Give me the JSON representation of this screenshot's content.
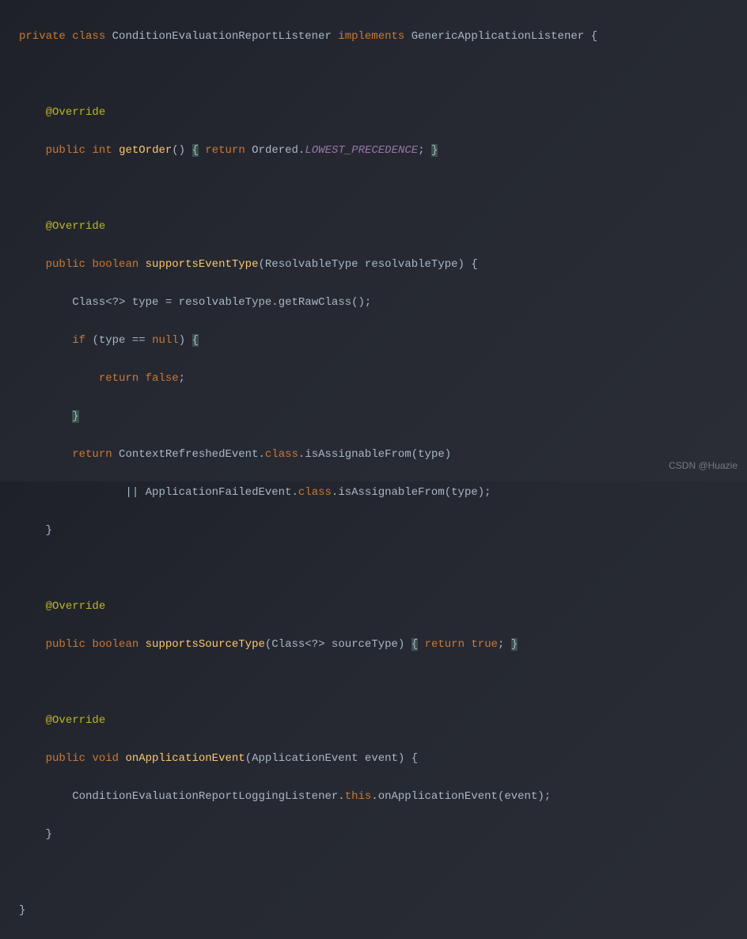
{
  "code": {
    "line1": {
      "kw_private": "private",
      "kw_class": "class",
      "class_name": "ConditionEvaluationReportListener",
      "kw_implements": "implements",
      "interface_name": "GenericApplicationListener",
      "brace_open": "{"
    },
    "line3": {
      "annotation": "@Override"
    },
    "line4": {
      "kw_public": "public",
      "kw_int": "int",
      "method": "getOrder",
      "parens": "()",
      "brace_open": "{",
      "kw_return": "return",
      "class_ref": "Ordered",
      "dot": ".",
      "static_field": "LOWEST_PRECEDENCE",
      "semi": ";",
      "brace_close": "}"
    },
    "line6": {
      "annotation": "@Override"
    },
    "line7": {
      "kw_public": "public",
      "kw_boolean": "boolean",
      "method": "supportsEventType",
      "paren_open": "(",
      "param_type": "ResolvableType",
      "param_name": "resolvableType",
      "paren_close": ")",
      "brace_open": "{"
    },
    "line8": {
      "type": "Class<?>",
      "var": "type",
      "eq": "=",
      "obj": "resolvableType",
      "dot": ".",
      "method": "getRawClass",
      "parens": "();"
    },
    "line9": {
      "kw_if": "if",
      "paren_open": "(",
      "var": "type",
      "op": "==",
      "kw_null": "null",
      "paren_close": ")",
      "brace_open": "{"
    },
    "line10": {
      "kw_return": "return",
      "kw_false": "false",
      "semi": ";"
    },
    "line11": {
      "brace_close": "}"
    },
    "line12": {
      "kw_return": "return",
      "class1": "ContextRefreshedEvent",
      "dot1": ".",
      "kw_class1": "class",
      "dot2": ".",
      "method": "isAssignableFrom",
      "paren_open": "(",
      "arg": "type",
      "paren_close": ")"
    },
    "line13": {
      "op": "||",
      "class2": "ApplicationFailedEvent",
      "dot1": ".",
      "kw_class2": "class",
      "dot2": ".",
      "method": "isAssignableFrom",
      "paren_open": "(",
      "arg": "type",
      "paren_close": ");"
    },
    "line14": {
      "brace_close": "}"
    },
    "line16": {
      "annotation": "@Override"
    },
    "line17": {
      "kw_public": "public",
      "kw_boolean": "boolean",
      "method": "supportsSourceType",
      "paren_open": "(",
      "param_type": "Class<?>",
      "param_name": "sourceType",
      "paren_close": ")",
      "brace_open": "{",
      "kw_return": "return",
      "kw_true": "true",
      "semi": ";",
      "brace_close": "}"
    },
    "line19": {
      "annotation": "@Override"
    },
    "line20": {
      "kw_public": "public",
      "kw_void": "void",
      "method": "onApplicationEvent",
      "paren_open": "(",
      "param_type": "ApplicationEvent",
      "param_name": "event",
      "paren_close": ")",
      "brace_open": "{"
    },
    "line21": {
      "class_ref": "ConditionEvaluationReportLoggingListener",
      "dot1": ".",
      "kw_this": "this",
      "dot2": ".",
      "method": "onApplicationEvent",
      "paren_open": "(",
      "arg": "event",
      "paren_close": ");"
    },
    "line22": {
      "brace_close": "}"
    },
    "line24": {
      "brace_close": "}"
    }
  },
  "watermark": "CSDN @Huazie"
}
